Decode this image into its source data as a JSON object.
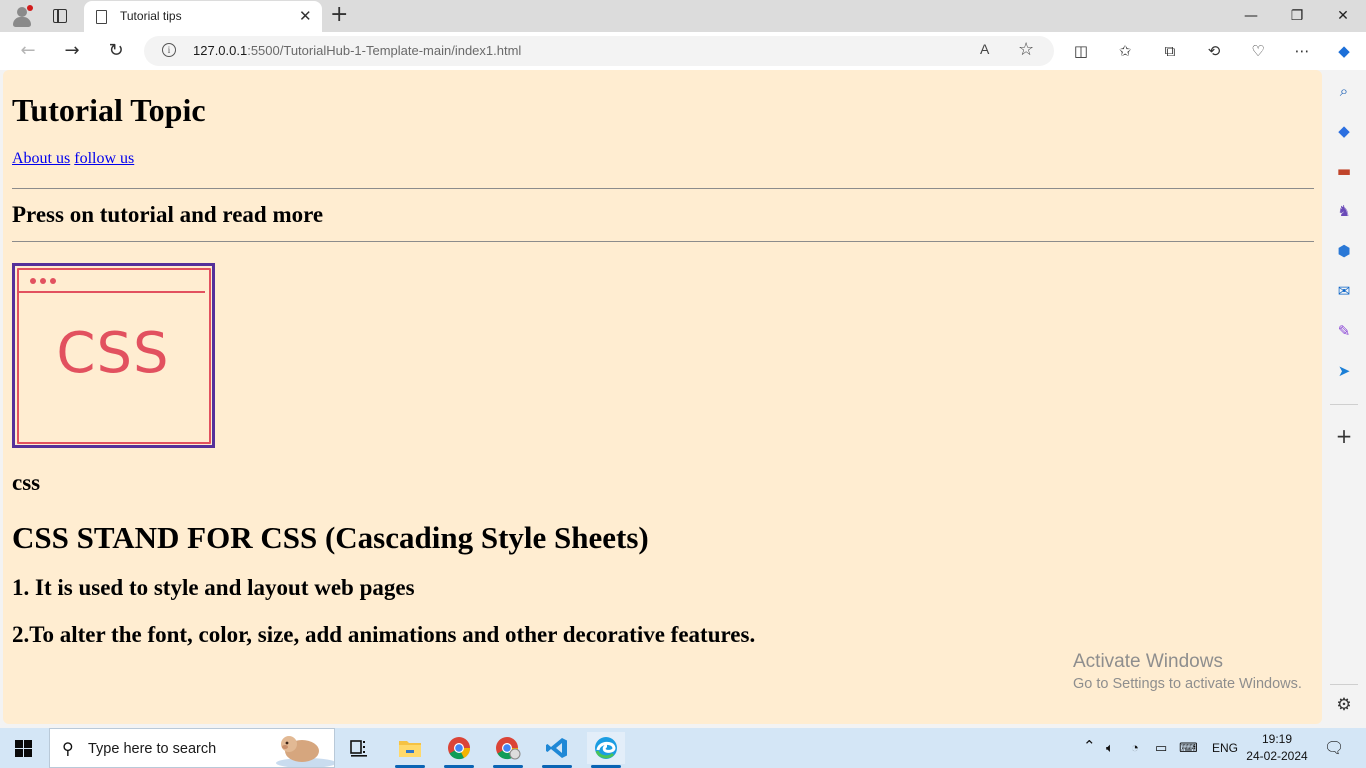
{
  "browser": {
    "tab": {
      "title": "Tutorial tips"
    },
    "address": {
      "host": "127.0.0.1",
      "rest": ":5500/TutorialHub-1-Template-main/index1.html"
    },
    "window_controls": {
      "minimize": "—",
      "restore": "❐",
      "close": "✕"
    }
  },
  "page": {
    "title": "Tutorial Topic",
    "links": [
      "About us",
      "follow us"
    ],
    "subheading": "Press on tutorial and read more",
    "thumbnail_text": "CSS",
    "image_caption": "css",
    "headline": "CSS STAND FOR CSS (Cascading Style Sheets)",
    "point1": "1. It is used to style and layout web pages",
    "point2": "2.To alter the font, color, size, add animations and other decorative features."
  },
  "watermark": {
    "line1": "Activate Windows",
    "line2": "Go to Settings to activate Windows."
  },
  "taskbar": {
    "search_placeholder": "Type here to search",
    "language": "ENG",
    "time": "19:19",
    "date": "24-02-2024"
  },
  "colors": {
    "page_bg": "#ffedd1",
    "link": "#0000ee",
    "thumb_border": "#55309a",
    "thumb_accent": "#e2515f"
  }
}
